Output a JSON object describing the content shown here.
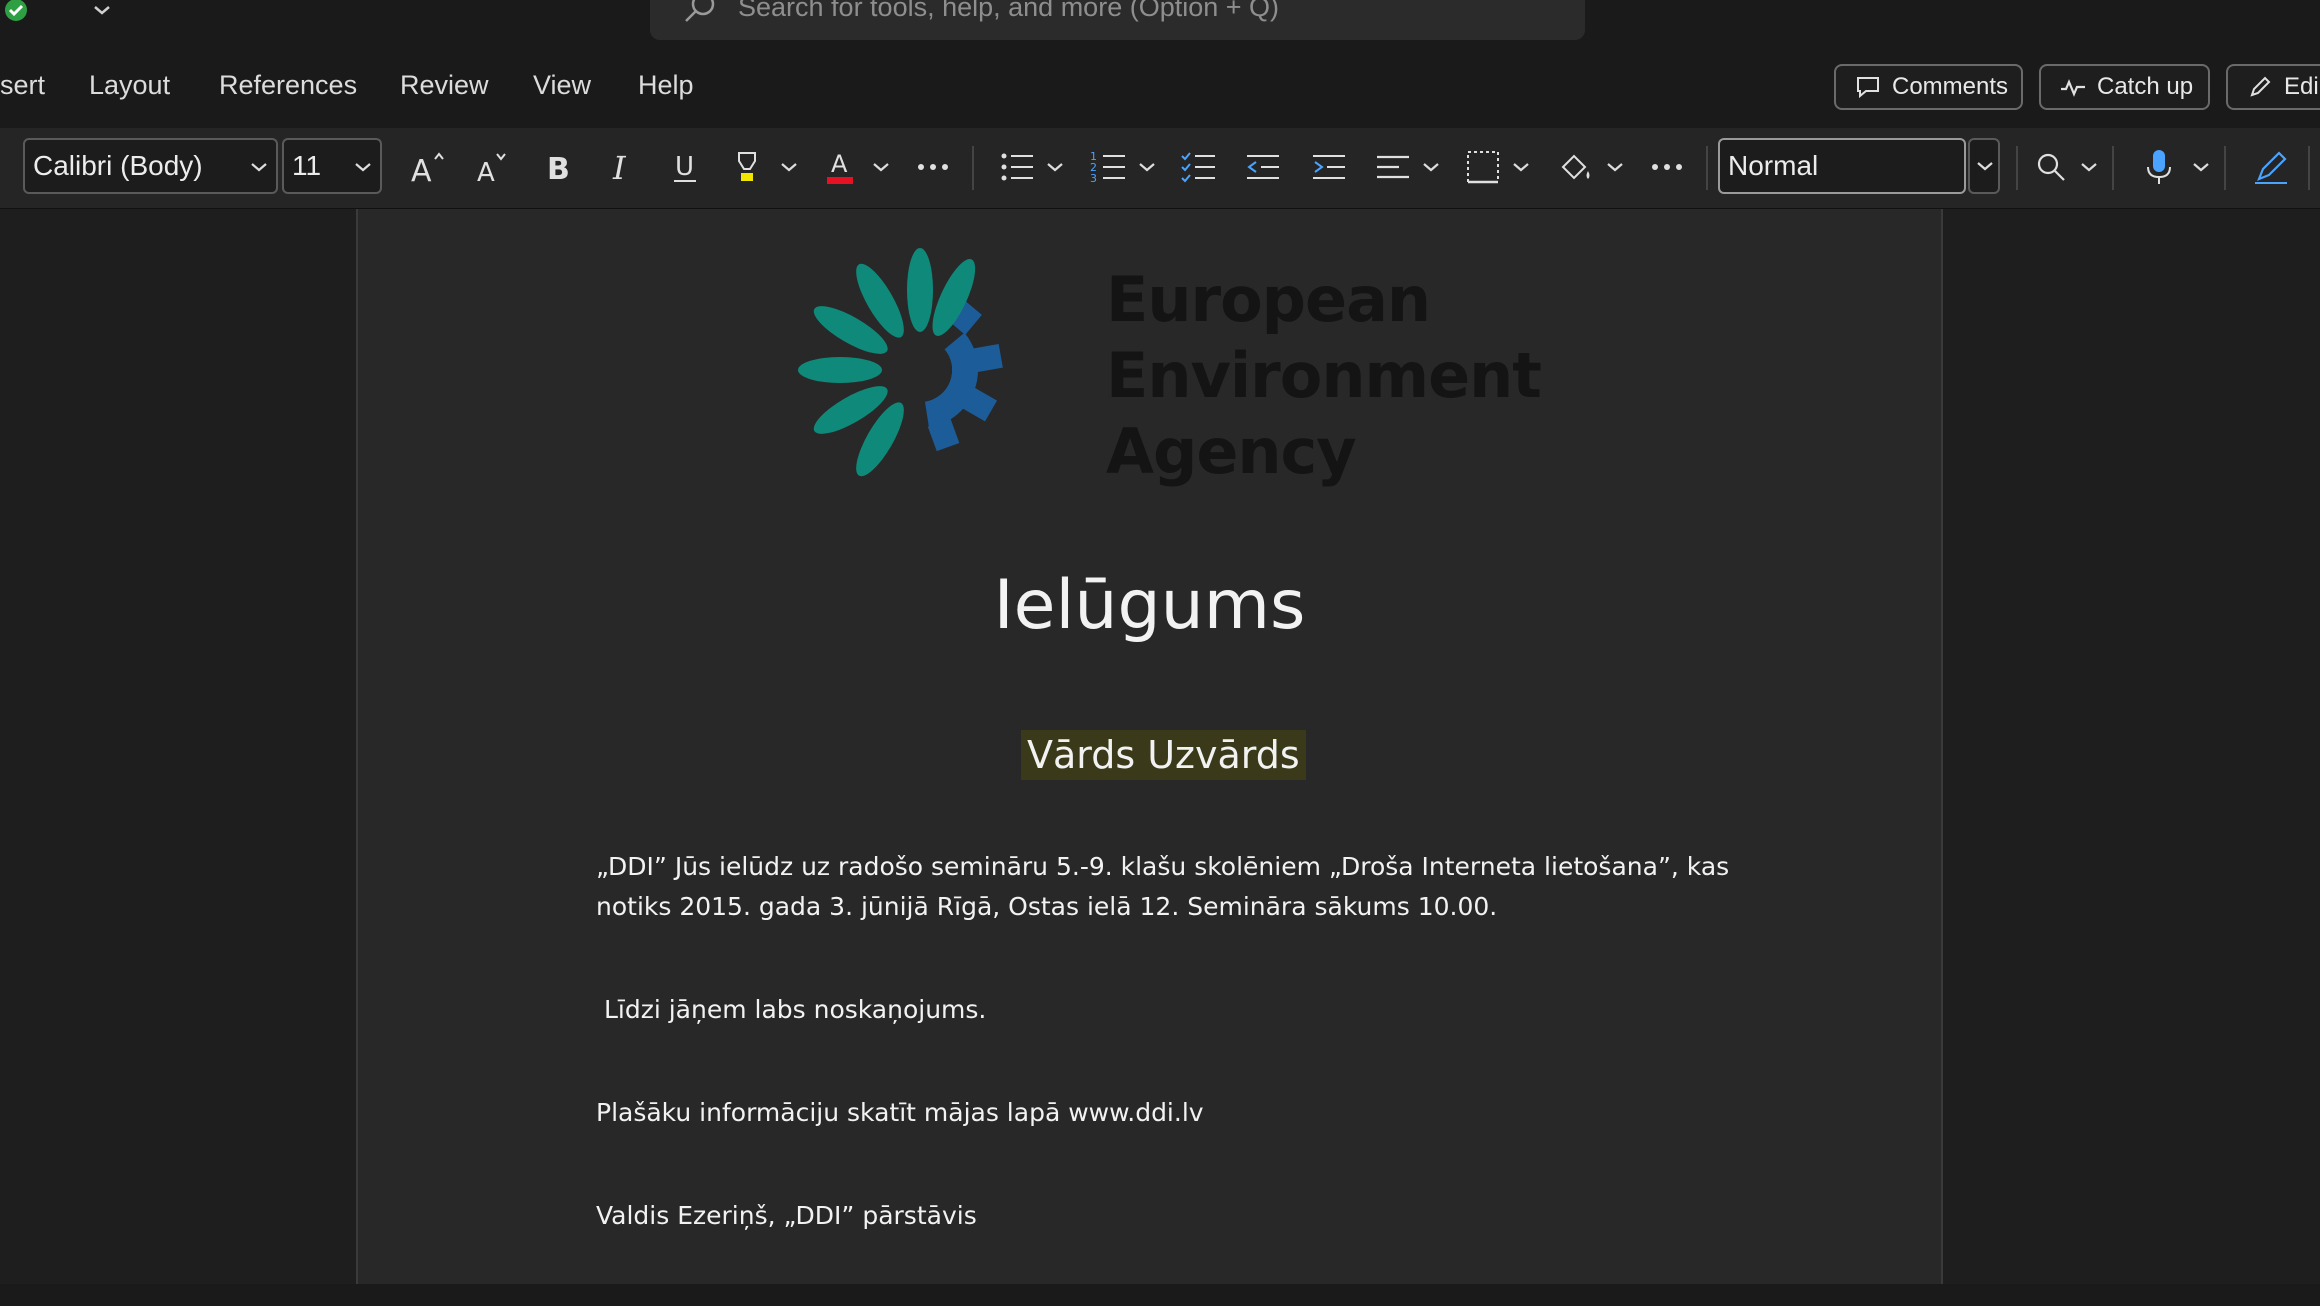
{
  "titlebar": {
    "search_placeholder": "Search for tools, help, and more (Option + Q)"
  },
  "ribbon": {
    "tabs": [
      "sert",
      "Layout",
      "References",
      "Review",
      "View",
      "Help"
    ],
    "comments_label": "Comments",
    "catchup_label": "Catch up",
    "edit_label": "Edi"
  },
  "toolbar": {
    "font_name": "Calibri (Body)",
    "font_size": "11",
    "style": "Normal",
    "font_color": "#e81123",
    "highlight_color": "#f2e600"
  },
  "document": {
    "logo_lines": [
      "European",
      "Environment",
      "Agency"
    ],
    "title": "Ielūgums",
    "name_field": "Vārds Uzvārds",
    "paragraph_line1": "„DDI” Jūs ielūdz uz radošo semināru 5.-9. klašu skolēniem „Droša Interneta lietošana”, kas",
    "paragraph_line2": "notiks 2015. gada 3. jūnijā Rīgā, Ostas ielā 12. Semināra sākums 10.00.",
    "line_greeting": " Līdzi jāņem labs noskaņojums.",
    "line_info": "Plašāku informāciju skatīt mājas lapā www.ddi.lv",
    "line_signature": "Valdis Ezeriņš, „DDI” pārstāvis"
  },
  "colors": {
    "logo_teal": "#0f8a7a",
    "logo_blue": "#1c5d99",
    "name_highlight": "#3a3a1a"
  }
}
